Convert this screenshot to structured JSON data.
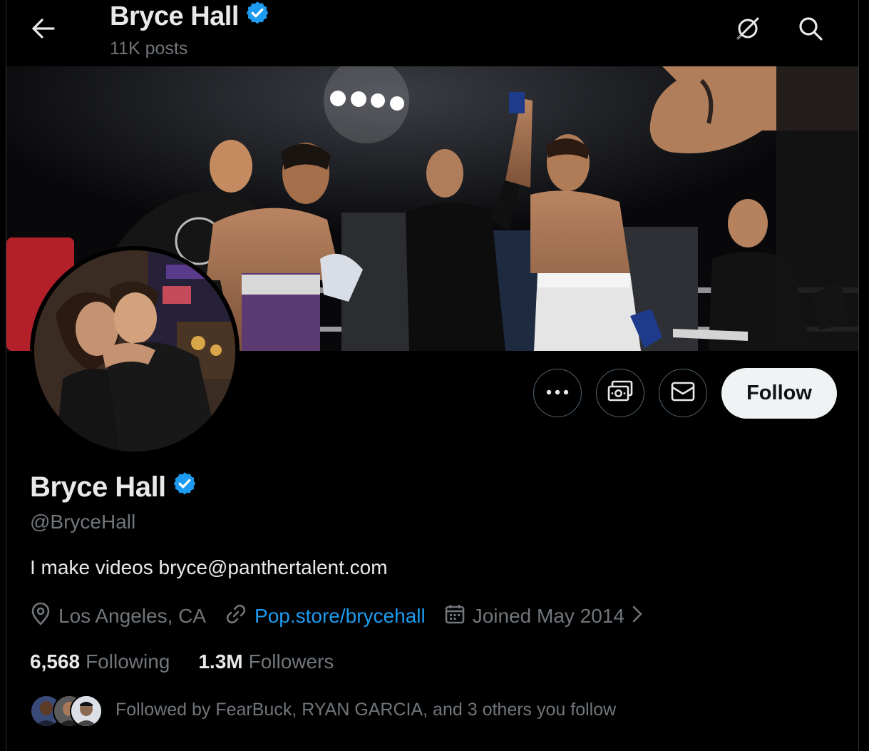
{
  "header": {
    "title": "Bryce Hall",
    "post_count": "11K posts",
    "icons": [
      "back-arrow-icon",
      "verified-badge-icon",
      "grok-icon",
      "search-icon"
    ]
  },
  "profile": {
    "name": "Bryce Hall",
    "handle": "@BryceHall",
    "bio": "I make videos bryce@panthertalent.com",
    "location": "Los Angeles, CA",
    "website": "Pop.store/brycehall",
    "joined": "Joined May 2014",
    "following_count": "6,568",
    "following_label": "Following",
    "followers_count": "1.3M",
    "followers_label": "Followers",
    "followed_by": "Followed by FearBuck, RYAN GARCIA, and 3 others you follow"
  },
  "actions": {
    "follow_label": "Follow",
    "icons": [
      "more-options-icon",
      "subscribe-money-icon",
      "message-envelope-icon"
    ]
  },
  "colors": {
    "background": "#000000",
    "text_primary": "#e7e9ea",
    "text_secondary": "#71767b",
    "link": "#1d9bf0",
    "verified": "#1d9bf0",
    "follow_button_bg": "#eff3f4"
  }
}
